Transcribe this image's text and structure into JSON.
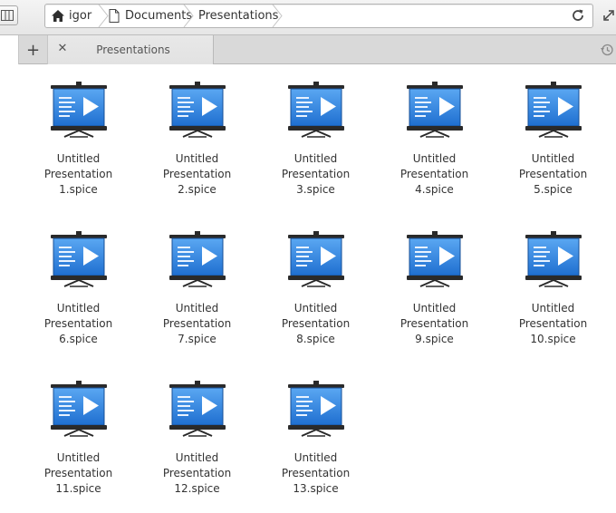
{
  "toolbar": {
    "breadcrumbs": [
      {
        "label": "igor",
        "icon": "home-icon"
      },
      {
        "label": "Documents",
        "icon": "document-icon"
      },
      {
        "label": "Presentations",
        "icon": ""
      }
    ]
  },
  "tabs": {
    "active": {
      "label": "Presentations"
    }
  },
  "files": [
    {
      "line1": "Untitled",
      "line2": "Presentation",
      "line3": "1.spice"
    },
    {
      "line1": "Untitled",
      "line2": "Presentation",
      "line3": "2.spice"
    },
    {
      "line1": "Untitled",
      "line2": "Presentation",
      "line3": "3.spice"
    },
    {
      "line1": "Untitled",
      "line2": "Presentation",
      "line3": "4.spice"
    },
    {
      "line1": "Untitled",
      "line2": "Presentation",
      "line3": "5.spice"
    },
    {
      "line1": "Untitled",
      "line2": "Presentation",
      "line3": "6.spice"
    },
    {
      "line1": "Untitled",
      "line2": "Presentation",
      "line3": "7.spice"
    },
    {
      "line1": "Untitled",
      "line2": "Presentation",
      "line3": "8.spice"
    },
    {
      "line1": "Untitled",
      "line2": "Presentation",
      "line3": "9.spice"
    },
    {
      "line1": "Untitled",
      "line2": "Presentation",
      "line3": "10.spice"
    },
    {
      "line1": "Untitled",
      "line2": "Presentation",
      "line3": "11.spice"
    },
    {
      "line1": "Untitled",
      "line2": "Presentation",
      "line3": "12.spice"
    },
    {
      "line1": "Untitled",
      "line2": "Presentation",
      "line3": "13.spice"
    }
  ],
  "colors": {
    "icon_blue": "#1f6fd0",
    "icon_blue_light": "#5aa7f2",
    "icon_frame": "#2a2a2a"
  }
}
